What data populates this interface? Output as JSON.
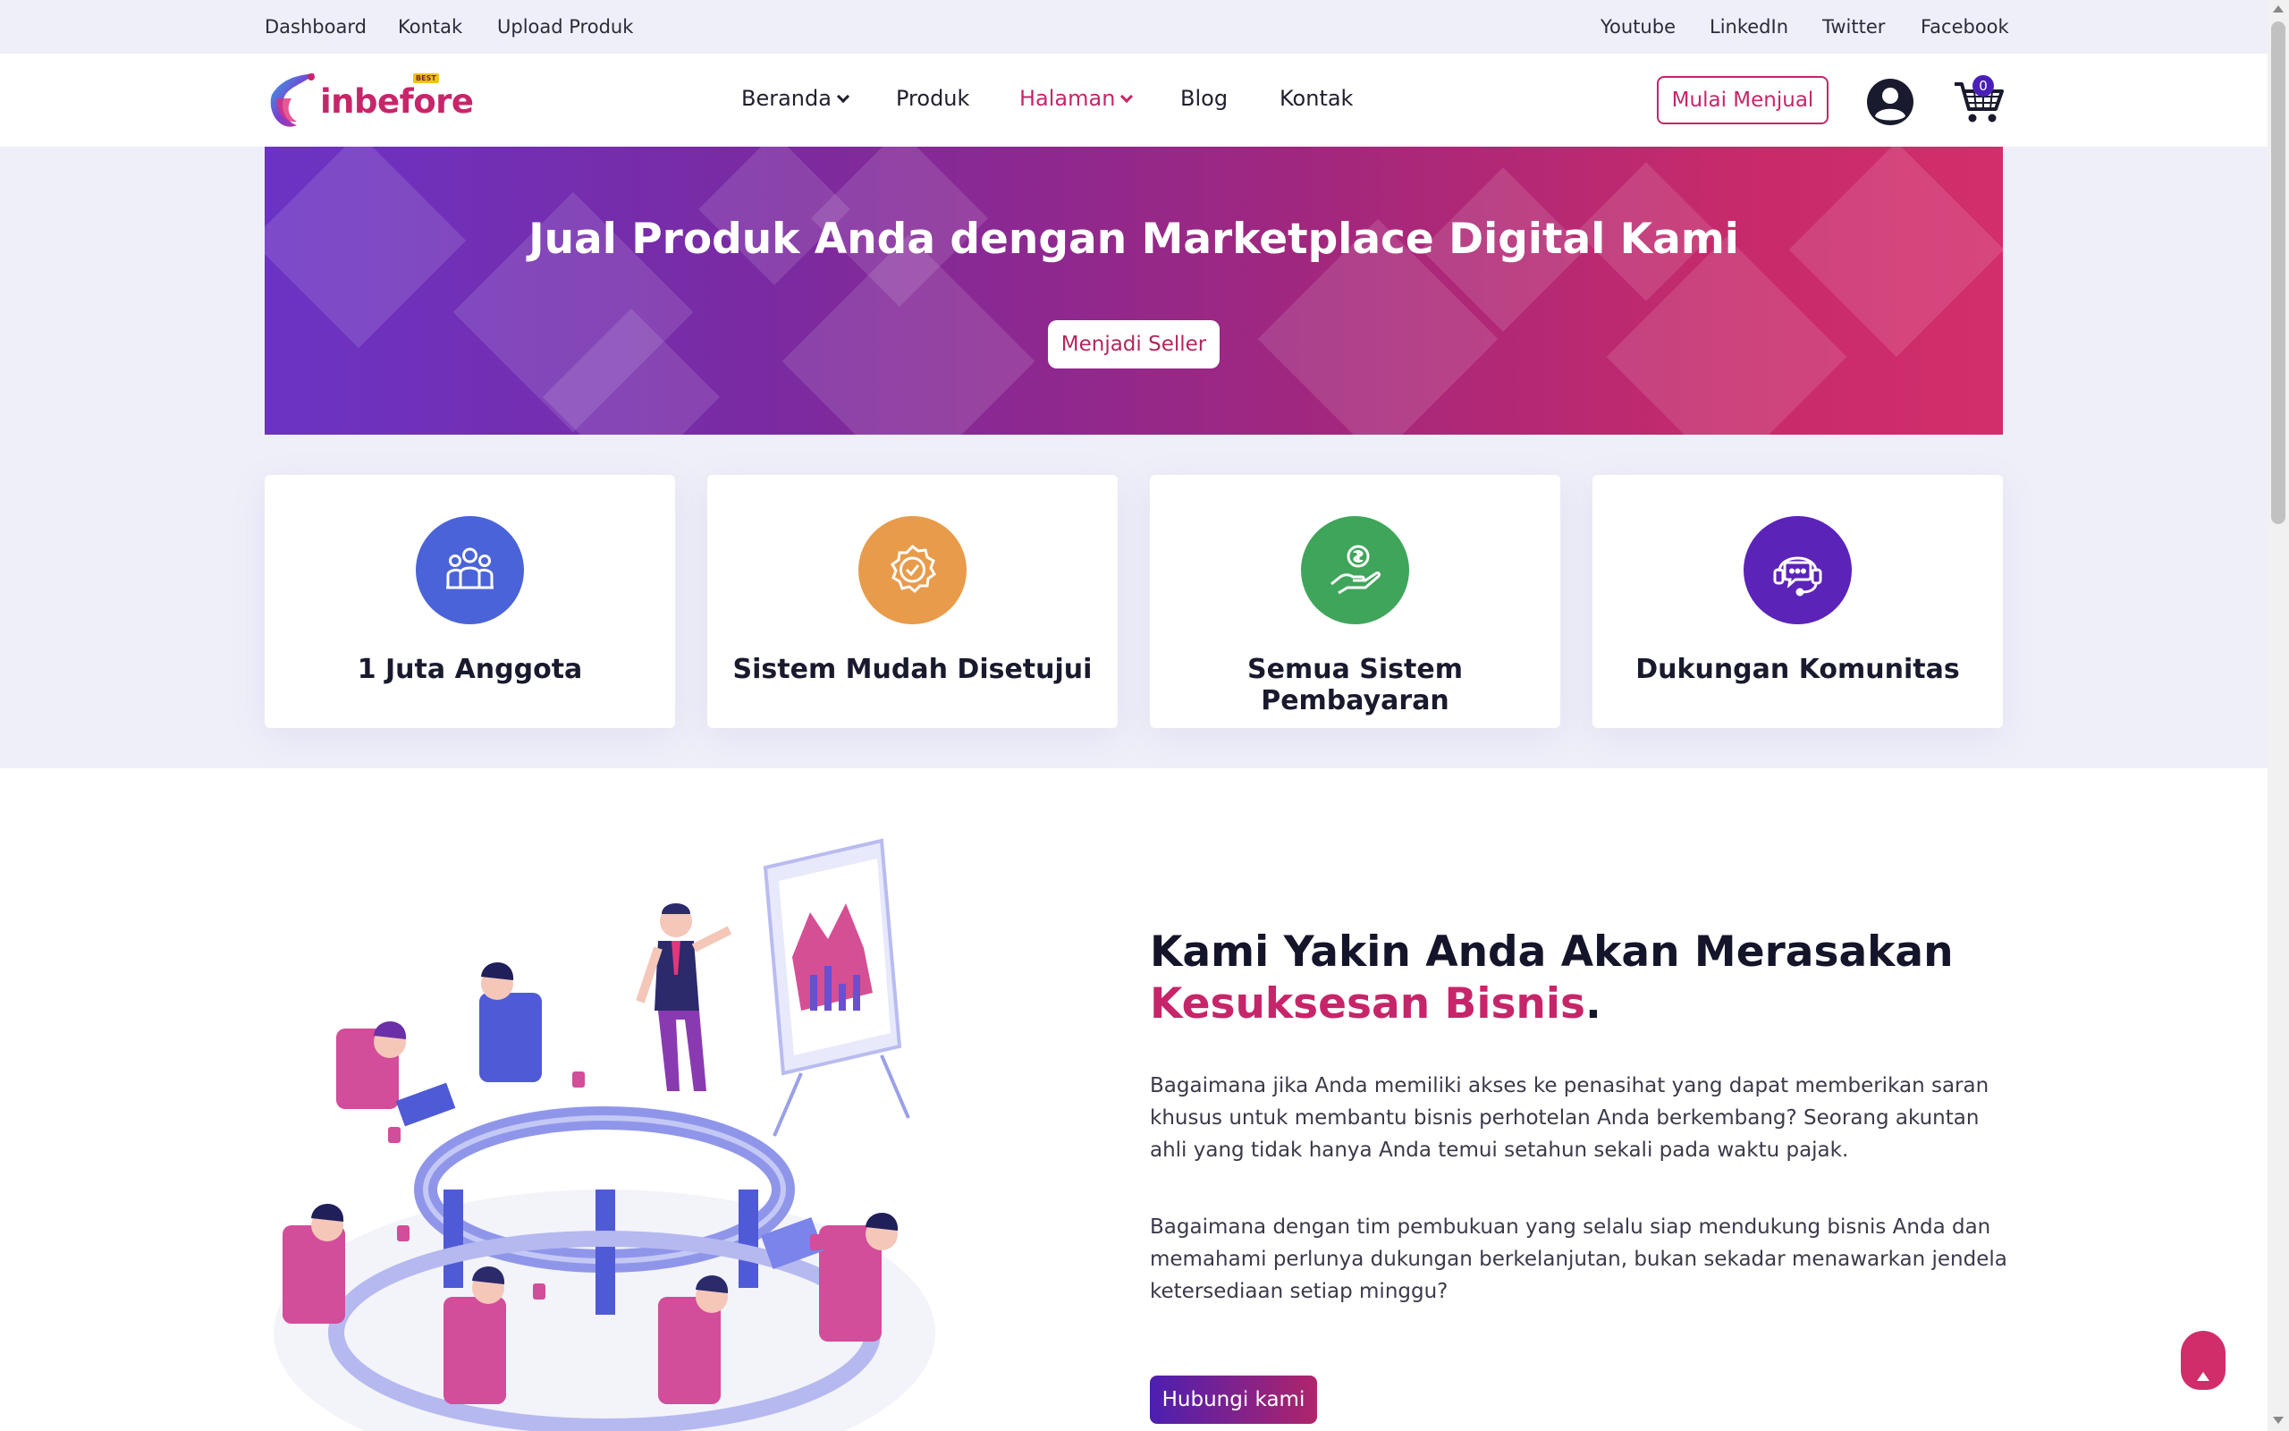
{
  "topbar": {
    "left_links": [
      "Dashboard",
      "Kontak",
      "Upload Produk"
    ],
    "right_links": [
      "Youtube",
      "LinkedIn",
      "Twitter",
      "Facebook"
    ]
  },
  "brand": {
    "name": "inbefore",
    "badge": "BEST"
  },
  "nav": {
    "items": [
      {
        "label": "Beranda",
        "dropdown": true
      },
      {
        "label": "Produk",
        "dropdown": false
      },
      {
        "label": "Halaman",
        "dropdown": true,
        "active": true
      },
      {
        "label": "Blog",
        "dropdown": false
      },
      {
        "label": "Kontak",
        "dropdown": false
      }
    ],
    "sell_button": "Mulai Menjual",
    "cart_count": "0",
    "user_icon": "user-icon",
    "cart_icon": "cart-icon"
  },
  "hero": {
    "title": "Jual Produk Anda dengan Marketplace Digital Kami",
    "button": "Menjadi Seller"
  },
  "features": [
    {
      "label": "1 Juta Anggota",
      "icon": "users-icon",
      "color": "#4a63d8"
    },
    {
      "label": "Sistem Mudah Disetujui",
      "icon": "badge-check-icon",
      "color": "#e89b4a"
    },
    {
      "label": "Semua Sistem Pembayaran",
      "icon": "payment-hand-icon",
      "color": "#3fa55b"
    },
    {
      "label": "Dukungan Komunitas",
      "icon": "headset-icon",
      "color": "#5b23b8"
    }
  ],
  "about": {
    "headline_part1": "Kami Yakin Anda Akan Merasakan",
    "headline_accent": "Kesuksesan Bisnis",
    "headline_end": ".",
    "paragraph1": "Bagaimana jika Anda memiliki akses ke penasihat yang dapat memberikan saran khusus untuk membantu bisnis perhotelan Anda berkembang? Seorang akuntan ahli yang tidak hanya Anda temui setahun sekali pada waktu pajak.",
    "paragraph2": "Bagaimana dengan tim pembukuan yang selalu siap mendukung bisnis Anda dan memahami perlunya dukungan berkelanjutan, bukan sekadar menawarkan jendela ketersediaan setiap minggu?",
    "button": "Hubungi kami"
  },
  "colors": {
    "accent": "#c7256a",
    "purple": "#4a1fb8",
    "lavender_bg": "#efeff9"
  }
}
